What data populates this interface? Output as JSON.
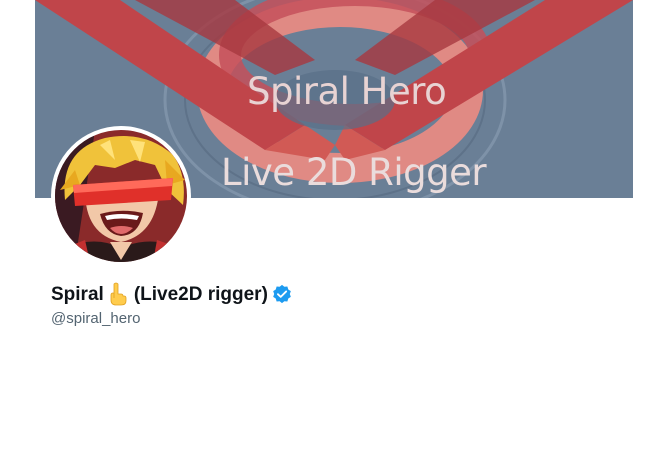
{
  "profile": {
    "banner": {
      "title": "Spiral Hero",
      "subtitle": "Live 2D Rigger",
      "background_color": "#6a7f96",
      "accent_color": "#d9463f"
    },
    "avatar_description_icon": "anime-avatar-image",
    "display_name": "Spiral",
    "display_name_emoji": "pointing-up-hand-icon",
    "display_name_suffix": "(Live2D rigger)",
    "verified_icon": "verified-badge-icon",
    "verified_color": "#1d9bf0",
    "handle": "@spiral_hero"
  }
}
